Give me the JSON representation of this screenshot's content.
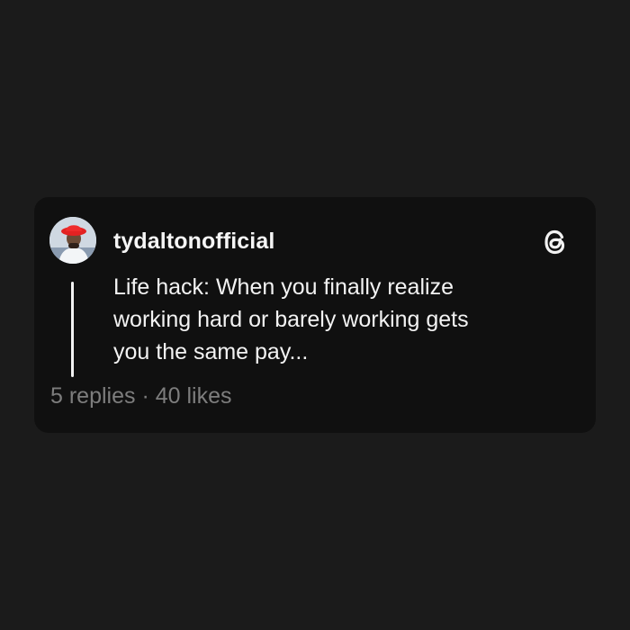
{
  "post": {
    "username": "tydaltonofficial",
    "text_lines": [
      "Life hack: When you finally realize",
      "working hard or barely working gets",
      "you the same pay..."
    ],
    "replies": "5 replies",
    "separator": "·",
    "likes": "40 likes"
  },
  "icons": {
    "avatar": "profile-photo",
    "brand": "threads-logo"
  },
  "colors": {
    "background": "#1b1b1b",
    "card": "#101010",
    "text": "#f3f3f3",
    "muted": "#7d7d7d"
  }
}
